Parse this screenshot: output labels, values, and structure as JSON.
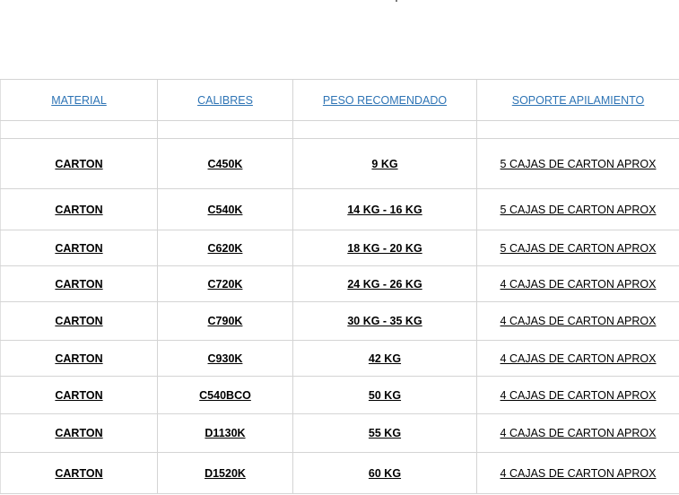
{
  "header": {
    "material": "MATERIAL",
    "calibres": "CALIBRES",
    "peso": "PESO RECOMENDADO",
    "soporte": "SOPORTE APILAMIENTO"
  },
  "rows": [
    {
      "material": "CARTON",
      "calibre": "C450K",
      "peso": "9 KG",
      "soporte": "5 CAJAS DE CARTON APROX"
    },
    {
      "material": "CARTON",
      "calibre": "C540K",
      "peso": "14 KG - 16 KG",
      "soporte": "5 CAJAS DE CARTON APROX"
    },
    {
      "material": "CARTON",
      "calibre": "C620K",
      "peso": "18 KG - 20 KG",
      "soporte": "5 CAJAS DE CARTON APROX"
    },
    {
      "material": "CARTON",
      "calibre": "C720K",
      "peso": "24 KG - 26 KG",
      "soporte": "4 CAJAS DE CARTON APROX"
    },
    {
      "material": "CARTON",
      "calibre": "C790K",
      "peso": "30 KG - 35 KG",
      "soporte": "4 CAJAS DE CARTON APROX"
    },
    {
      "material": "CARTON",
      "calibre": "C930K",
      "peso": "42 KG",
      "soporte": "4 CAJAS DE CARTON APROX"
    },
    {
      "material": "CARTON",
      "calibre": "C540BCO",
      "peso": "50 KG",
      "soporte": "4 CAJAS DE CARTON APROX"
    },
    {
      "material": "CARTON",
      "calibre": "D1130K",
      "peso": "55 KG",
      "soporte": "4 CAJAS DE CARTON APROX"
    },
    {
      "material": "CARTON",
      "calibre": "D1520K",
      "peso": "60 KG",
      "soporte": "4 CAJAS DE CARTON APROX"
    }
  ],
  "colors": {
    "header_link": "#2e74b5",
    "grid_line": "#d4d4d4"
  }
}
